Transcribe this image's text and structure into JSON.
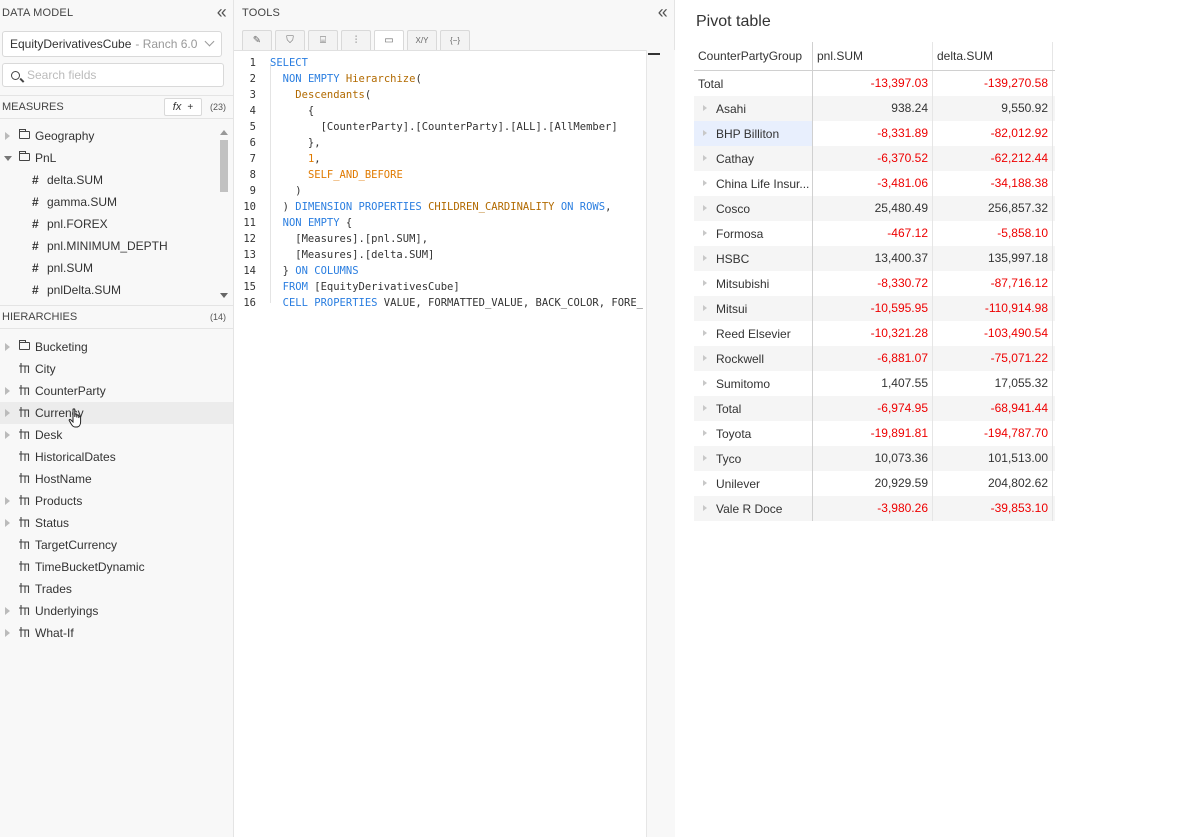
{
  "data_model": {
    "header": "DATA MODEL",
    "cube": {
      "name": "EquityDerivativesCube",
      "server": "- Ranch 6.0"
    },
    "search_placeholder": "Search fields",
    "measures": {
      "header": "MEASURES",
      "count": "(23)",
      "fx_label": "fx",
      "items": [
        {
          "type": "folder",
          "label": "Geography",
          "expanded": false
        },
        {
          "type": "folder",
          "label": "PnL",
          "expanded": true
        },
        {
          "type": "measure",
          "label": "delta.SUM"
        },
        {
          "type": "measure",
          "label": "gamma.SUM"
        },
        {
          "type": "measure",
          "label": "pnl.FOREX"
        },
        {
          "type": "measure",
          "label": "pnl.MINIMUM_DEPTH"
        },
        {
          "type": "measure",
          "label": "pnl.SUM"
        },
        {
          "type": "measure",
          "label": "pnlDelta.SUM"
        }
      ]
    },
    "hierarchies": {
      "header": "HIERARCHIES",
      "count": "(14)",
      "items": [
        {
          "type": "folder",
          "label": "Bucketing",
          "expandable": true
        },
        {
          "type": "hier",
          "label": "City",
          "expandable": false
        },
        {
          "type": "hier",
          "label": "CounterParty",
          "expandable": true
        },
        {
          "type": "hier",
          "label": "Currency",
          "expandable": true,
          "hover": true
        },
        {
          "type": "hier",
          "label": "Desk",
          "expandable": true
        },
        {
          "type": "hier",
          "label": "HistoricalDates",
          "expandable": false
        },
        {
          "type": "hier",
          "label": "HostName",
          "expandable": false
        },
        {
          "type": "hier",
          "label": "Products",
          "expandable": true
        },
        {
          "type": "hier",
          "label": "Status",
          "expandable": true
        },
        {
          "type": "hier",
          "label": "TargetCurrency",
          "expandable": false
        },
        {
          "type": "hier",
          "label": "TimeBucketDynamic",
          "expandable": false
        },
        {
          "type": "hier",
          "label": "Trades",
          "expandable": false
        },
        {
          "type": "hier",
          "label": "Underlyings",
          "expandable": true
        },
        {
          "type": "hier",
          "label": "What-If",
          "expandable": true
        }
      ]
    }
  },
  "tools": {
    "header": "TOOLS",
    "toolbar": [
      {
        "name": "pencil-icon",
        "glyph": "✎"
      },
      {
        "name": "filter-icon",
        "glyph": "⛉"
      },
      {
        "name": "paint-roller-icon",
        "glyph": "⌸"
      },
      {
        "name": "sliders-icon",
        "glyph": "⫶"
      },
      {
        "name": "terminal-icon",
        "glyph": "▭",
        "active": true
      },
      {
        "name": "xy-icon",
        "glyph": "X/Y"
      },
      {
        "name": "braces-icon",
        "glyph": "{−}"
      }
    ],
    "code": [
      [
        [
          "kw",
          "SELECT"
        ]
      ],
      [
        [
          "tx",
          "  "
        ],
        [
          "kw",
          "NON EMPTY"
        ],
        [
          "tx",
          " "
        ],
        [
          "fn",
          "Hierarchize"
        ],
        [
          "tx",
          "("
        ]
      ],
      [
        [
          "tx",
          "    "
        ],
        [
          "fn",
          "Descendants"
        ],
        [
          "tx",
          "("
        ]
      ],
      [
        [
          "tx",
          "      {"
        ]
      ],
      [
        [
          "tx",
          "        [CounterParty].[CounterParty].[ALL].[AllMember]"
        ]
      ],
      [
        [
          "tx",
          "      },"
        ]
      ],
      [
        [
          "tx",
          "      "
        ],
        [
          "nm",
          "1"
        ],
        [
          "tx",
          ","
        ]
      ],
      [
        [
          "tx",
          "      "
        ],
        [
          "nm",
          "SELF_AND_BEFORE"
        ]
      ],
      [
        [
          "tx",
          "    )"
        ]
      ],
      [
        [
          "tx",
          "  ) "
        ],
        [
          "kw",
          "DIMENSION PROPERTIES"
        ],
        [
          "tx",
          " "
        ],
        [
          "fn",
          "CHILDREN_CARDINALITY"
        ],
        [
          "tx",
          " "
        ],
        [
          "kw",
          "ON ROWS"
        ],
        [
          "tx",
          ","
        ]
      ],
      [
        [
          "tx",
          "  "
        ],
        [
          "kw",
          "NON EMPTY"
        ],
        [
          "tx",
          " {"
        ]
      ],
      [
        [
          "tx",
          "    [Measures].[pnl.SUM],"
        ]
      ],
      [
        [
          "tx",
          "    [Measures].[delta.SUM]"
        ]
      ],
      [
        [
          "tx",
          "  } "
        ],
        [
          "kw",
          "ON COLUMNS"
        ]
      ],
      [
        [
          "tx",
          "  "
        ],
        [
          "kw",
          "FROM"
        ],
        [
          "tx",
          " [EquityDerivativesCube]"
        ]
      ],
      [
        [
          "tx",
          "  "
        ],
        [
          "kw",
          "CELL PROPERTIES"
        ],
        [
          "tx",
          " VALUE, FORMATTED_VALUE, BACK_COLOR, FORE_"
        ]
      ]
    ]
  },
  "pivot": {
    "title": "Pivot table",
    "columns": [
      "CounterPartyGroup",
      "pnl.SUM",
      "delta.SUM"
    ],
    "rows": [
      {
        "label": "Total",
        "pnl": "-13,397.03",
        "delta": "-139,270.58",
        "top": true
      },
      {
        "label": "Asahi",
        "pnl": "938.24",
        "delta": "9,550.92"
      },
      {
        "label": "BHP Billiton",
        "pnl": "-8,331.89",
        "delta": "-82,012.92",
        "selected": true
      },
      {
        "label": "Cathay",
        "pnl": "-6,370.52",
        "delta": "-62,212.44"
      },
      {
        "label": "China Life Insur...",
        "pnl": "-3,481.06",
        "delta": "-34,188.38"
      },
      {
        "label": "Cosco",
        "pnl": "25,480.49",
        "delta": "256,857.32"
      },
      {
        "label": "Formosa",
        "pnl": "-467.12",
        "delta": "-5,858.10"
      },
      {
        "label": "HSBC",
        "pnl": "13,400.37",
        "delta": "135,997.18"
      },
      {
        "label": "Mitsubishi",
        "pnl": "-8,330.72",
        "delta": "-87,716.12"
      },
      {
        "label": "Mitsui",
        "pnl": "-10,595.95",
        "delta": "-110,914.98"
      },
      {
        "label": "Reed Elsevier",
        "pnl": "-10,321.28",
        "delta": "-103,490.54"
      },
      {
        "label": "Rockwell",
        "pnl": "-6,881.07",
        "delta": "-75,071.22"
      },
      {
        "label": "Sumitomo",
        "pnl": "1,407.55",
        "delta": "17,055.32"
      },
      {
        "label": "Total",
        "pnl": "-6,974.95",
        "delta": "-68,941.44"
      },
      {
        "label": "Toyota",
        "pnl": "-19,891.81",
        "delta": "-194,787.70"
      },
      {
        "label": "Tyco",
        "pnl": "10,073.36",
        "delta": "101,513.00"
      },
      {
        "label": "Unilever",
        "pnl": "20,929.59",
        "delta": "204,802.62"
      },
      {
        "label": "Vale R Doce",
        "pnl": "-3,980.26",
        "delta": "-39,853.10"
      }
    ]
  },
  "colors": {
    "negative": "#e00000",
    "keyword": "#2a7ee0",
    "function": "#b26a00",
    "number": "#e07a00",
    "selection": "#e8effd"
  }
}
